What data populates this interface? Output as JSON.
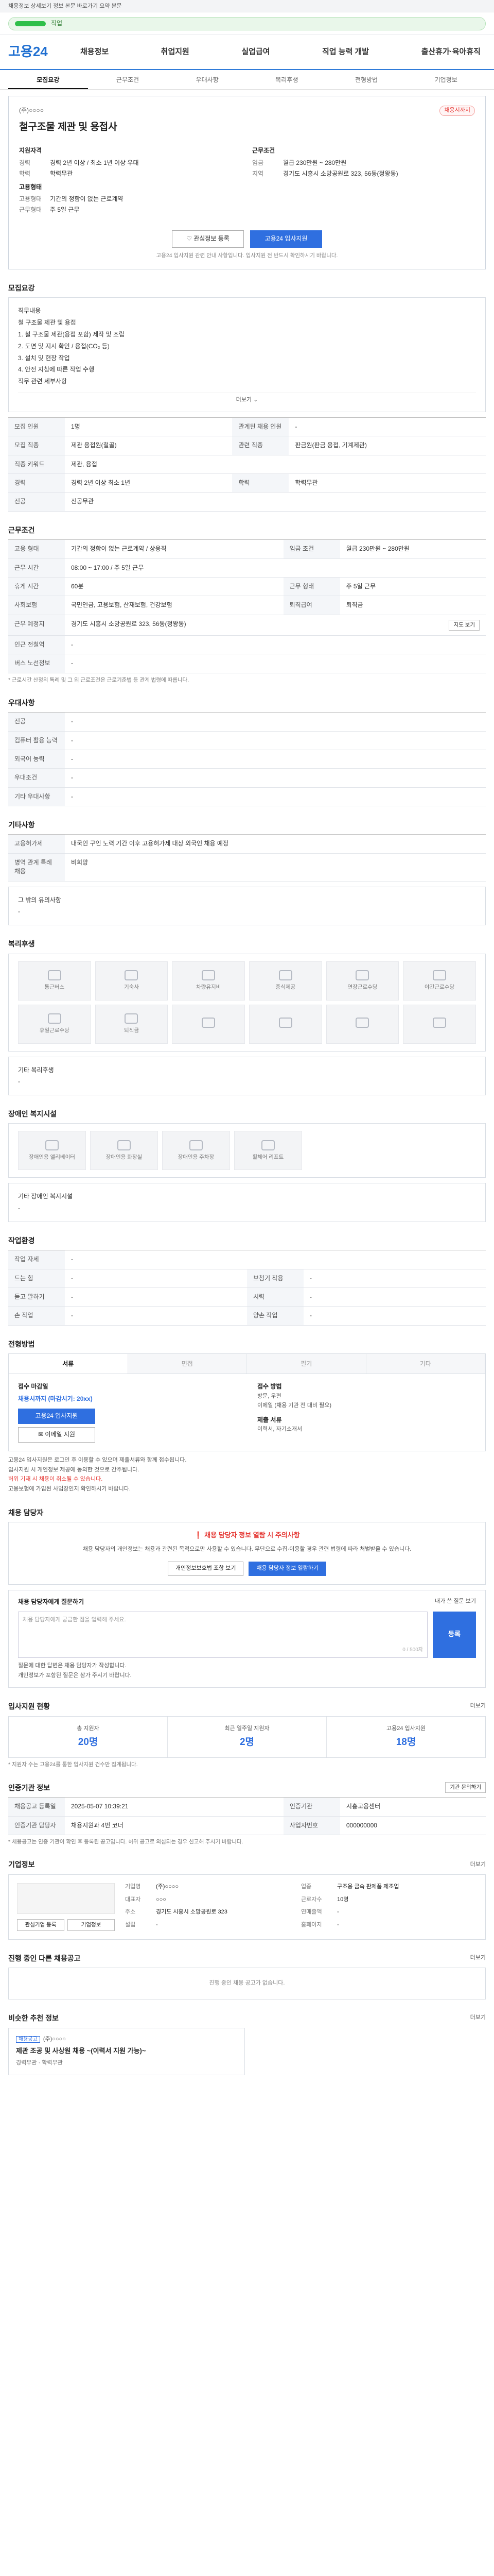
{
  "topbar": {
    "text": "채용정보 상세보기 정보 본문 바로가기 요약 본문"
  },
  "search": {
    "text": "직업"
  },
  "brand": {
    "logo": "고용24"
  },
  "gnb": [
    "채용정보",
    "취업지원",
    "실업급여",
    "직업 능력 개발",
    "출산휴가·육아휴직"
  ],
  "tabs": [
    "모집요강",
    "근무조건",
    "우대사항",
    "복리후생",
    "전형방법",
    "기업정보"
  ],
  "job": {
    "company": "(주)○○○○",
    "badge": "채용시까지",
    "title": "철구조물 제관 및 용접사",
    "qualify_title": "지원자격",
    "qualify": [
      {
        "k": "경력",
        "v": "경력 2년 이상 / 최소 1년 이상 우대"
      },
      {
        "k": "학력",
        "v": "학력무관"
      }
    ],
    "cond_title": "근무조건",
    "cond": [
      {
        "k": "임금",
        "v": "월급 230만원 ~ 280만원"
      },
      {
        "k": "지역",
        "v": "경기도 시흥시 소망공원로 323, 56동(정왕동)"
      }
    ],
    "type_title": "고용형태",
    "type": [
      {
        "k": "고용형태",
        "v": "기간의 정함이 없는 근로계약"
      },
      {
        "k": "근무형태",
        "v": "주 5일 근무"
      }
    ],
    "btn_scrap": "관심정보 등록",
    "btn_apply": "고용24 입사지원",
    "notice": "고용24 입사지원 관련 안내 사항입니다. 입사지원 전 반드시 확인하시기 바랍니다."
  },
  "recruit": {
    "title": "모집요강",
    "box_title": "직무내용",
    "lines": [
      "철 구조물 제관 및 용접",
      "1. 철 구조물 제관(용접 포함) 제작 및 조립",
      "2. 도면 및 지시 확인 / 용접(CO₂ 등)",
      "3. 설치 및 현장 작업",
      "4. 안전 지침에 따른 작업 수행",
      "직무 관련 세부사항"
    ],
    "more": "더보기",
    "rows": [
      {
        "k": "모집 인원",
        "v": "1명",
        "k2": "관계된 채용 인원",
        "v2": "-"
      },
      {
        "k": "모집 직종",
        "v": "제관 용접원(철골)",
        "k2": "관련 직종",
        "v2": "판금원(판금 용접, 기계제관)"
      },
      {
        "k": "직종 키워드",
        "v": "제관, 용접",
        "k2": "",
        "v2": ""
      },
      {
        "k": "경력",
        "v": "경력 2년 이상 최소 1년",
        "k2": "학력",
        "v2": "학력무관"
      },
      {
        "k": "전공",
        "v": "전공무관",
        "k2": "",
        "v2": ""
      }
    ]
  },
  "work": {
    "title": "근무조건",
    "rows": [
      {
        "k": "고용 형태",
        "v": "기간의 정함이 없는 근로계약 / 상용직",
        "k2": "임금 조건",
        "v2": "월급 230만원 ~ 280만원"
      },
      {
        "k": "근무 시간",
        "v": "08:00 ~ 17:00 / 주 5일 근무",
        "k2": "",
        "v2": ""
      },
      {
        "k": "휴게 시간",
        "v": "60분",
        "k2": "근무 형태",
        "v2": "주 5일 근무"
      },
      {
        "k": "사회보험",
        "v": "국민연금, 고용보험, 산재보험, 건강보험",
        "k2": "퇴직급여",
        "v2": "퇴직금"
      },
      {
        "k": "근무 예정지",
        "v": "경기도 시흥시 소망공원로 323, 56동(정왕동)",
        "k2": "",
        "v2": ""
      },
      {
        "k": "인근 전철역",
        "v": "-",
        "k2": "",
        "v2": ""
      },
      {
        "k": "버스 노선정보",
        "v": "-",
        "k2": "",
        "v2": ""
      }
    ],
    "map_btn": "지도 보기",
    "caption": "* 근로시간 산정의 특례 및 그 외 근로조건은 근로기준법 등 관계 법령에 따릅니다."
  },
  "prefer": {
    "title": "우대사항",
    "rows": [
      {
        "k": "전공",
        "v": "-"
      },
      {
        "k": "컴퓨터 활용 능력",
        "v": "-"
      },
      {
        "k": "외국어 능력",
        "v": "-"
      },
      {
        "k": "우대조건",
        "v": "-"
      },
      {
        "k": "기타 우대사항",
        "v": "-"
      }
    ]
  },
  "etc": {
    "title": "기타사항",
    "rows": [
      {
        "k": "고용허가제",
        "v": "내국인 구인 노력 기간 이후 고용허가제 대상 외국인 채용 예정"
      },
      {
        "k": "병역 관계 특례 채용",
        "v": "비희망"
      }
    ],
    "box_title": "그 밖의 유의사항",
    "box_text": "-"
  },
  "welfare": {
    "title": "복리후생",
    "items": [
      "통근버스",
      "기숙사",
      "차량유지비",
      "중식제공",
      "연장근로수당",
      "야간근로수당",
      "휴일근로수당",
      "퇴직금",
      "",
      "",
      "",
      ""
    ],
    "box_title": "기타 복리후생",
    "box_text": "-"
  },
  "disabled": {
    "title": "장애인 복지시설",
    "items": [
      "장애인용 엘리베이터",
      "장애인용 화장실",
      "장애인용 주차장",
      "휠체어 리프트"
    ],
    "box_title": "기타 장애인 복지시설",
    "box_text": "-"
  },
  "condition": {
    "title": "작업환경",
    "rows": [
      {
        "k": "작업 자세",
        "v": "-",
        "k2": "",
        "v2": ""
      },
      {
        "k": "드는 힘",
        "v": "-",
        "k2": "보청기 착용",
        "v2": "-"
      },
      {
        "k": "듣고 말하기",
        "v": "-",
        "k2": "시력",
        "v2": "-"
      },
      {
        "k": "손 작업",
        "v": "-",
        "k2": "양손 작업",
        "v2": "-"
      }
    ]
  },
  "screen": {
    "title": "전형방법",
    "tabs": [
      "서류",
      "면접",
      "필기",
      "기타"
    ],
    "left_title": "접수 마감일",
    "deadline": "채용시까지 (마감시기: 20xx)",
    "btn1": "고용24 입사지원",
    "btn2": "이메일 지원",
    "right_title": "접수 방법",
    "methods": [
      "방문, 우편",
      "이메일 (채용 기관 전 대비 필요)"
    ],
    "docs_title": "제출 서류",
    "docs": "이력서, 자기소개서",
    "bullets": [
      "고용24 입사지원은 로그인 후 이용할 수 있으며 제출서류와 함께 접수됩니다.",
      "입사지원 시 개인정보 제공에 동의한 것으로 간주됩니다.",
      "허위 기재 시 채용이 취소될 수 있습니다.",
      "고용보험에 가입된 사업장인지 확인하시기 바랍니다."
    ]
  },
  "manager": {
    "title": "채용 담당자",
    "warn": "채용 담당자 정보 열람 시 주의사항",
    "desc": "채용 담당자의 개인정보는 채용과 관련된 목적으로만 사용할 수 있습니다. 무단으로 수집·이용할 경우 관련 법령에 따라 처벌받을 수 있습니다.",
    "btn1": "개인정보보호법 조항 보기",
    "btn2": "채용 담당자 정보 열람하기",
    "qa_title": "채용 담당자에게 질문하기",
    "qa_hint": "내가 쓴 질문 보기",
    "qa_placeholder": "채용 담당자에게 궁금한 점을 입력해 주세요.",
    "qa_count": "0 / 500자",
    "qa_btn": "등록",
    "qa_notes": [
      "질문에 대한 답변은 채용 담당자가 작성합니다.",
      "개인정보가 포함된 질문은 삼가 주시기 바랍니다."
    ]
  },
  "status": {
    "title": "입사지원 현황",
    "more": "더보기",
    "items": [
      {
        "lab": "총 지원자",
        "num": "20명"
      },
      {
        "lab": "최근 일주일 지원자",
        "num": "2명"
      },
      {
        "lab": "고용24 입사지원",
        "num": "18명"
      }
    ],
    "note": "* 지원자 수는 고용24를 통한 입사지원 건수만 집계됩니다."
  },
  "agency": {
    "title": "인증기관 정보",
    "btn": "기관 문의하기",
    "rows": [
      {
        "k": "채용공고 등록일",
        "v": "2025-05-07 10:39:21",
        "k2": "인증기관",
        "v2": "시흥고용센터"
      },
      {
        "k": "인증기관 담당자",
        "v": "채용지원과 4번 코너",
        "k2": "사업자번호",
        "v2": "000000000"
      }
    ],
    "caption": "* 채용공고는 인증 기관이 확인 후 등록된 공고입니다. 허위 공고로 의심되는 경우 신고해 주시기 바랍니다."
  },
  "company": {
    "title": "기업정보",
    "more": "더보기",
    "btn1": "관심기업 등록",
    "btn2": "기업정보",
    "info": [
      {
        "k": "기업명",
        "v": "(주)○○○○",
        "k2": "업종",
        "v2": "구조용 금속 판제품 제조업"
      },
      {
        "k": "대표자",
        "v": "○○○",
        "k2": "근로자수",
        "v2": "10명"
      },
      {
        "k": "주소",
        "v": "경기도 시흥시 소망공원로 323",
        "k2": "연매출액",
        "v2": "-"
      },
      {
        "k": "설립",
        "v": "-",
        "k2": "홈페이지",
        "v2": "-"
      }
    ]
  },
  "others": {
    "title": "진행 중인 다른 채용공고",
    "more": "더보기",
    "empty": "진행 중인 채용 공고가 없습니다."
  },
  "similar": {
    "title": "비슷한 추천 정보",
    "more": "더보기",
    "tag": "채용공고",
    "company": "(주)○○○○",
    "card_title": "제관 조공 및 사상원 채용 ~(이력서 지원 가능)~",
    "card_meta": "경력무관 · 학력무관"
  }
}
